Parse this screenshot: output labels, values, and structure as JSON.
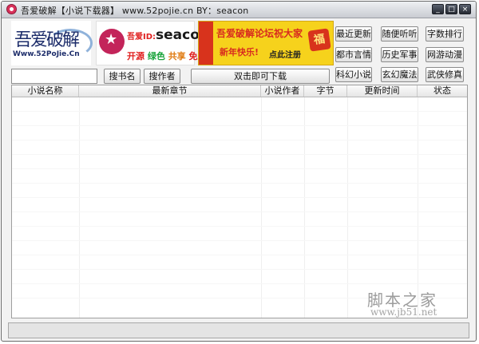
{
  "window": {
    "title": "吾爱破解【小说下载器】 www.52pojie.cn BY：seacon",
    "controls": [
      "_",
      "□",
      "×"
    ]
  },
  "banners": {
    "logo_main": "吾爱破解",
    "logo_sub": "Www.52PoJie.Cn",
    "ad1_title_prefix": "吾爱ID:",
    "ad1_title": "seacon",
    "ad1_tags": [
      "开源",
      "绿色",
      "共享",
      "免费"
    ],
    "ad1_tag_colors": [
      "#e0201f",
      "#19a33b",
      "#e07b12",
      "#e0201f"
    ],
    "ad2_line1": "吾爱破解论坛祝大家",
    "ad2_line2": "新年快乐!",
    "ad2_line3": "点此注册",
    "ad2_badge": "福"
  },
  "category_buttons": [
    "最近更新",
    "随便听听",
    "字数排行",
    "都市言情",
    "历史军事",
    "网游动漫",
    "科幻小说",
    "玄幻魔法",
    "武侠修真"
  ],
  "search": {
    "value": "",
    "by_title_button": "搜书名",
    "by_author_button": "搜作者",
    "download_button": "双击即可下载"
  },
  "table": {
    "columns": [
      "小说名称",
      "最新章节",
      "小说作者",
      "字节",
      "更新时间",
      "状态"
    ],
    "rows": []
  },
  "watermark": {
    "main": "脚本之家",
    "sub": "www.jb51.net"
  }
}
